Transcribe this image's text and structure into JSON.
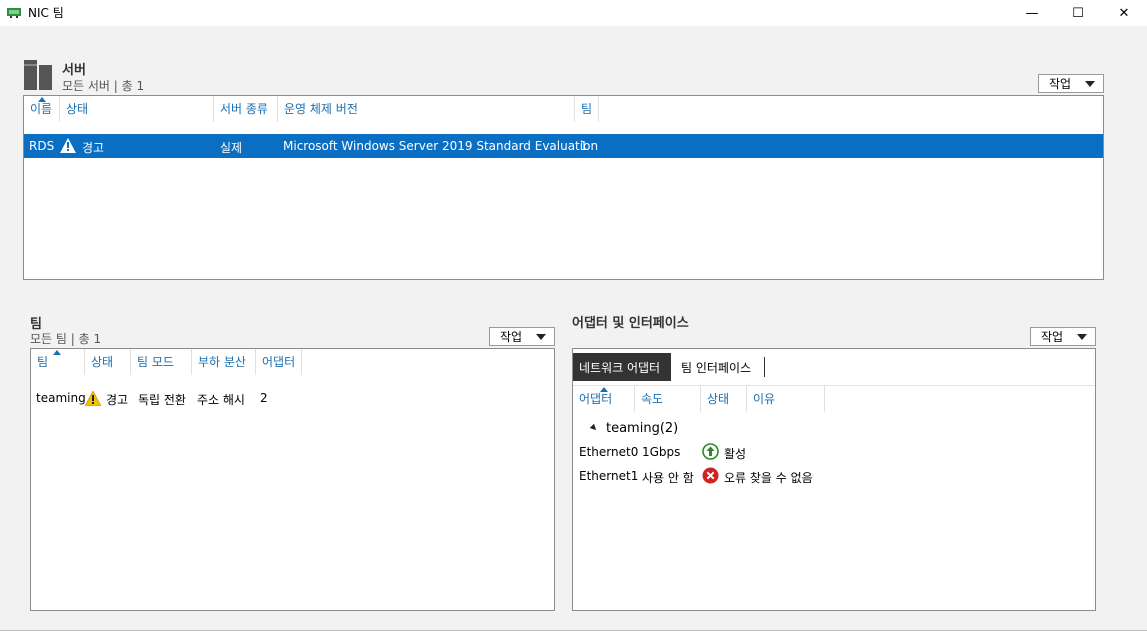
{
  "window": {
    "title": "NIC 팀",
    "minimize": "—",
    "maximize": "☐",
    "close": "✕"
  },
  "servers": {
    "title": "서버",
    "subtitle": "모든 서버 | 총 1",
    "task_label": "작업",
    "columns": [
      "이름",
      "상태",
      "서버 종류",
      "운영 체제 버전",
      "팀"
    ],
    "rows": [
      {
        "name": "RDS",
        "status": "경고",
        "type": "실제",
        "os": "Microsoft Windows Server 2019 Standard Evaluation",
        "teams": "1"
      }
    ]
  },
  "teams": {
    "title": "팀",
    "subtitle": "모든 팀 | 총 1",
    "task_label": "작업",
    "columns": [
      "팀",
      "상태",
      "팀 모드",
      "부하 분산",
      "어댑터"
    ],
    "rows": [
      {
        "team": "teaming",
        "status": "경고",
        "mode": "독립 전환",
        "lb": "주소 해시",
        "adapters": "2"
      }
    ]
  },
  "adapters": {
    "title": "어댑터 및 인터페이스",
    "task_label": "작업",
    "tabs": [
      "네트워크 어댑터",
      "팀 인터페이스"
    ],
    "columns": [
      "어댑터",
      "속도",
      "상태",
      "이유"
    ],
    "group": "teaming(2)",
    "rows": [
      {
        "adapter": "Ethernet0",
        "speed": "1Gbps",
        "status": "활성",
        "reason": ""
      },
      {
        "adapter": "Ethernet1",
        "speed": "사용 안 함",
        "status": "",
        "reason": "오류 찾을 수 없음"
      }
    ]
  },
  "colors": {
    "accent": "#0a6fc2",
    "header_text": "#1a6fb0",
    "warn": "#f2c200",
    "ok": "#2a8a2a",
    "error": "#d32020"
  }
}
